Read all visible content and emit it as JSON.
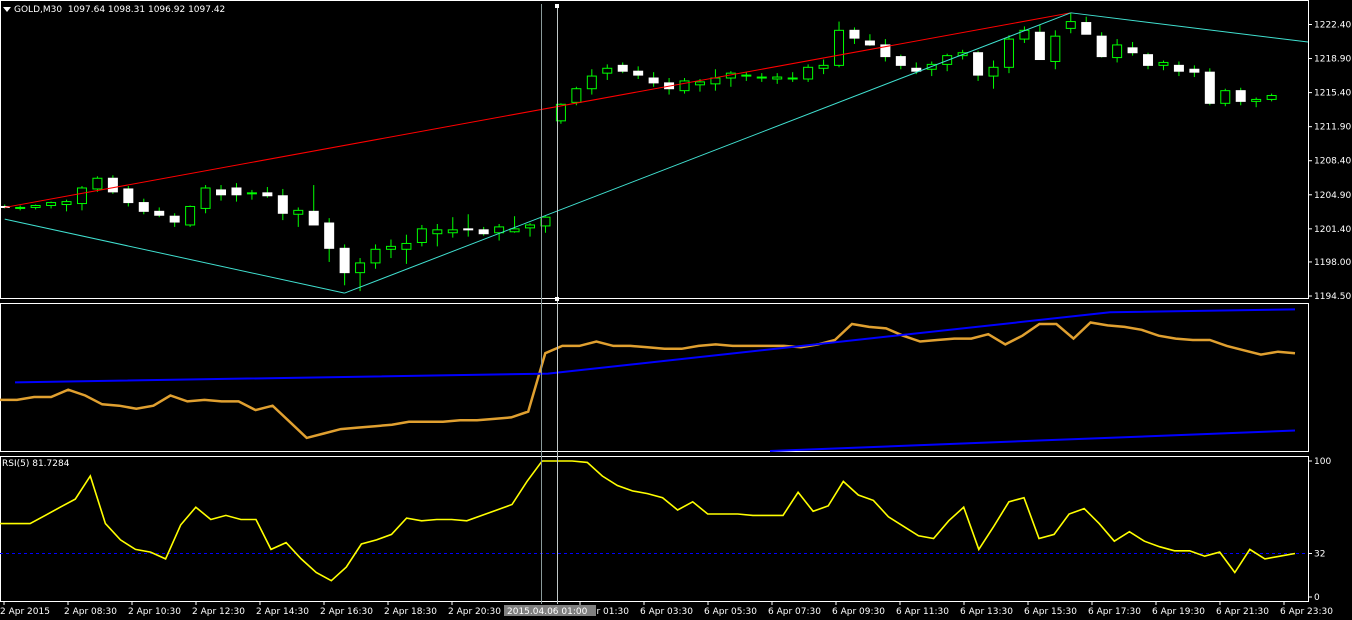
{
  "header": {
    "symbol": "GOLD,M30",
    "ohlc": "1097.64 1098.31 1096.92 1097.42"
  },
  "rsi": {
    "label": "RSI(5) 81.7284"
  },
  "cursor_time_label": "2015.04.06 01:00",
  "colors": {
    "bull_candle": "#00ff00",
    "bear_candle": "#ffffff",
    "trend_red": "#ff0000",
    "trend_cyan": "#40e0d0",
    "orange_line": "#e0a030",
    "blue_line": "#0000ff",
    "rsi_line": "#ffff00",
    "rsi_level": "#0000ff"
  },
  "chart_data": [
    {
      "type": "candlestick",
      "price_axis": [
        "1222.40",
        "1218.90",
        "1215.40",
        "1211.90",
        "1208.40",
        "1204.90",
        "1201.40",
        "1198.00",
        "1194.50"
      ],
      "time_axis": [
        "2 Apr 2015",
        "2 Apr 08:30",
        "2 Apr 10:30",
        "2 Apr 12:30",
        "2 Apr 14:30",
        "2 Apr 16:30",
        "2 Apr 18:30",
        "2 Apr 20:30",
        "",
        "6 Apr 01:30",
        "6 Apr 03:30",
        "6 Apr 05:30",
        "6 Apr 07:30",
        "6 Apr 09:30",
        "6 Apr 11:30",
        "6 Apr 13:30",
        "6 Apr 15:30",
        "6 Apr 17:30",
        "6 Apr 19:30",
        "6 Apr 21:30",
        "6 Apr 23:30"
      ],
      "ylim": [
        1194.5,
        1224.3
      ],
      "candles": [
        [
          1203.7,
          1203.9,
          1203.5,
          1203.6
        ],
        [
          1203.5,
          1203.8,
          1203.3,
          1203.6
        ],
        [
          1203.6,
          1203.9,
          1203.4,
          1203.8
        ],
        [
          1203.8,
          1204.2,
          1203.5,
          1204.1
        ],
        [
          1203.9,
          1204.4,
          1203.2,
          1204.2
        ],
        [
          1204.0,
          1205.8,
          1203.3,
          1205.6
        ],
        [
          1205.5,
          1206.8,
          1205.2,
          1206.6
        ],
        [
          1206.6,
          1206.9,
          1205.0,
          1205.2
        ],
        [
          1205.5,
          1205.8,
          1203.7,
          1204.1
        ],
        [
          1204.1,
          1204.5,
          1202.9,
          1203.2
        ],
        [
          1203.2,
          1203.6,
          1202.6,
          1202.8
        ],
        [
          1202.7,
          1203.0,
          1201.6,
          1202.1
        ],
        [
          1201.8,
          1203.8,
          1201.6,
          1203.7
        ],
        [
          1203.5,
          1205.9,
          1203.0,
          1205.6
        ],
        [
          1205.4,
          1205.9,
          1204.3,
          1204.9
        ],
        [
          1205.6,
          1206.1,
          1204.2,
          1204.9
        ],
        [
          1205.0,
          1205.4,
          1204.4,
          1205.1
        ],
        [
          1205.1,
          1205.7,
          1204.6,
          1204.8
        ],
        [
          1204.8,
          1205.5,
          1202.3,
          1203.0
        ],
        [
          1202.9,
          1203.6,
          1201.6,
          1203.3
        ],
        [
          1203.2,
          1205.9,
          1202.6,
          1201.8
        ],
        [
          1202.0,
          1202.5,
          1198.0,
          1199.4
        ],
        [
          1199.4,
          1199.8,
          1195.6,
          1196.9
        ],
        [
          1196.9,
          1198.4,
          1195.0,
          1197.9
        ],
        [
          1197.9,
          1199.8,
          1197.3,
          1199.3
        ],
        [
          1199.3,
          1200.3,
          1198.4,
          1199.6
        ],
        [
          1199.3,
          1200.8,
          1197.8,
          1199.9
        ],
        [
          1200.0,
          1201.8,
          1199.6,
          1201.4
        ],
        [
          1200.9,
          1201.9,
          1199.6,
          1201.3
        ],
        [
          1201.0,
          1202.6,
          1200.5,
          1201.3
        ],
        [
          1201.4,
          1202.9,
          1200.6,
          1201.3
        ],
        [
          1201.3,
          1201.6,
          1200.7,
          1200.9
        ],
        [
          1201.0,
          1201.9,
          1200.2,
          1201.6
        ],
        [
          1201.1,
          1202.7,
          1201.0,
          1201.4
        ],
        [
          1201.5,
          1202.0,
          1200.6,
          1201.8
        ],
        [
          1201.7,
          1202.7,
          1201.0,
          1202.6
        ],
        [
          1212.5,
          1214.3,
          1212.2,
          1214.2
        ],
        [
          1214.4,
          1216.0,
          1214.1,
          1215.8
        ],
        [
          1215.8,
          1217.8,
          1215.2,
          1217.1
        ],
        [
          1217.4,
          1218.3,
          1216.7,
          1217.9
        ],
        [
          1218.2,
          1218.5,
          1217.4,
          1217.6
        ],
        [
          1217.6,
          1218.1,
          1216.8,
          1217.2
        ],
        [
          1216.9,
          1217.5,
          1216.0,
          1216.4
        ],
        [
          1216.4,
          1216.9,
          1215.2,
          1215.8
        ],
        [
          1215.6,
          1216.9,
          1215.3,
          1216.6
        ],
        [
          1216.2,
          1216.8,
          1215.5,
          1216.5
        ],
        [
          1216.3,
          1217.8,
          1215.6,
          1216.9
        ],
        [
          1216.9,
          1217.6,
          1216.0,
          1217.4
        ],
        [
          1217.1,
          1217.5,
          1216.6,
          1217.2
        ],
        [
          1216.9,
          1217.4,
          1216.5,
          1217.0
        ],
        [
          1216.8,
          1217.4,
          1216.3,
          1217.0
        ],
        [
          1216.9,
          1217.5,
          1216.5,
          1216.9
        ],
        [
          1216.8,
          1218.3,
          1216.5,
          1218.0
        ],
        [
          1217.9,
          1218.8,
          1217.3,
          1218.2
        ],
        [
          1218.2,
          1222.7,
          1218.0,
          1221.8
        ],
        [
          1221.8,
          1222.1,
          1220.4,
          1221.0
        ],
        [
          1220.7,
          1221.4,
          1220.2,
          1220.3
        ],
        [
          1220.3,
          1220.9,
          1218.6,
          1219.1
        ],
        [
          1219.1,
          1219.3,
          1217.8,
          1218.2
        ],
        [
          1217.9,
          1218.5,
          1217.3,
          1217.6
        ],
        [
          1217.8,
          1218.6,
          1217.1,
          1218.3
        ],
        [
          1218.3,
          1219.4,
          1217.6,
          1219.2
        ],
        [
          1219.2,
          1219.8,
          1218.8,
          1219.5
        ],
        [
          1219.5,
          1219.7,
          1216.6,
          1217.2
        ],
        [
          1217.1,
          1218.7,
          1215.8,
          1218.0
        ],
        [
          1218.0,
          1221.3,
          1217.4,
          1220.9
        ],
        [
          1220.9,
          1222.2,
          1220.5,
          1221.8
        ],
        [
          1221.6,
          1222.4,
          1218.9,
          1218.8
        ],
        [
          1218.6,
          1221.8,
          1217.8,
          1221.2
        ],
        [
          1222.0,
          1223.6,
          1221.5,
          1222.7
        ],
        [
          1222.6,
          1223.2,
          1221.5,
          1221.4
        ],
        [
          1221.2,
          1221.6,
          1219.0,
          1219.1
        ],
        [
          1219.0,
          1220.9,
          1218.5,
          1220.3
        ],
        [
          1220.0,
          1220.6,
          1219.2,
          1219.5
        ],
        [
          1219.3,
          1219.5,
          1217.8,
          1218.2
        ],
        [
          1218.2,
          1218.7,
          1217.7,
          1218.5
        ],
        [
          1218.2,
          1218.6,
          1217.1,
          1217.6
        ],
        [
          1217.8,
          1218.2,
          1217.0,
          1217.5
        ],
        [
          1217.5,
          1217.9,
          1214.1,
          1214.3
        ],
        [
          1214.3,
          1215.8,
          1214.0,
          1215.6
        ],
        [
          1215.6,
          1215.9,
          1214.1,
          1214.5
        ],
        [
          1214.5,
          1214.9,
          1213.9,
          1214.7
        ],
        [
          1214.7,
          1215.3,
          1214.5,
          1215.1
        ]
      ],
      "candle_fields": [
        "open",
        "high",
        "low",
        "close"
      ],
      "trendlines": [
        {
          "color": "red",
          "from": [
            0,
            1203.6
          ],
          "to": [
            69,
            1223.6
          ]
        },
        {
          "color": "cyan",
          "from": [
            0,
            1202.4
          ],
          "to": [
            22,
            1194.8
          ]
        },
        {
          "color": "cyan",
          "from": [
            22,
            1194.8
          ],
          "to": [
            69,
            1223.6
          ]
        },
        {
          "color": "cyan",
          "from": [
            69,
            1223.6
          ],
          "to": [
            84,
            1220.6
          ]
        }
      ]
    },
    {
      "type": "line",
      "panel": "indicator",
      "series": [
        {
          "values": [
            0.35,
            0.35,
            0.37,
            0.37,
            0.42,
            0.38,
            0.32,
            0.31,
            0.29,
            0.31,
            0.38,
            0.34,
            0.35,
            0.34,
            0.34,
            0.28,
            0.31,
            0.2,
            0.09,
            0.12,
            0.15,
            0.16,
            0.17,
            0.18,
            0.2,
            0.2,
            0.2,
            0.21,
            0.21,
            0.22,
            0.23,
            0.27,
            0.67,
            0.72,
            0.72,
            0.75,
            0.72,
            0.72,
            0.71,
            0.7,
            0.7,
            0.72,
            0.73,
            0.72,
            0.72,
            0.72,
            0.72,
            0.71,
            0.73,
            0.76,
            0.87,
            0.85,
            0.84,
            0.79,
            0.75,
            0.76,
            0.77,
            0.77,
            0.8,
            0.73,
            0.79,
            0.87,
            0.87,
            0.77,
            0.88,
            0.86,
            0.85,
            0.83,
            0.79,
            0.77,
            0.76,
            0.76,
            0.72,
            0.69,
            0.66,
            0.68,
            0.67
          ]
        },
        {
          "values": [
            0.47,
            0.53,
            0.95,
            0.97
          ]
        },
        {
          "values": [
            0.0,
            0.14
          ]
        }
      ]
    },
    {
      "type": "line",
      "panel": "rsi",
      "ylim": [
        0,
        100
      ],
      "yticks": [
        "100",
        "32",
        "0"
      ],
      "level": 32,
      "series": [
        {
          "name": "RSI(5)",
          "values": [
            54,
            54,
            54,
            60,
            66,
            72,
            89,
            54,
            42,
            35,
            33,
            28,
            53,
            66,
            57,
            60,
            57,
            57,
            35,
            40,
            28,
            18,
            12,
            22,
            39,
            42,
            46,
            58,
            56,
            57,
            57,
            56,
            60,
            64,
            68,
            85,
            100,
            100,
            100,
            99,
            89,
            82,
            78,
            76,
            73,
            64,
            70,
            61,
            61,
            61,
            60,
            60,
            60,
            77,
            63,
            67,
            85,
            75,
            71,
            59,
            52,
            45,
            43,
            56,
            66,
            35,
            52,
            70,
            73,
            43,
            46,
            61,
            65,
            54,
            41,
            48,
            41,
            37,
            34,
            34,
            30,
            33,
            18,
            35,
            28,
            30,
            32
          ]
        }
      ]
    }
  ]
}
